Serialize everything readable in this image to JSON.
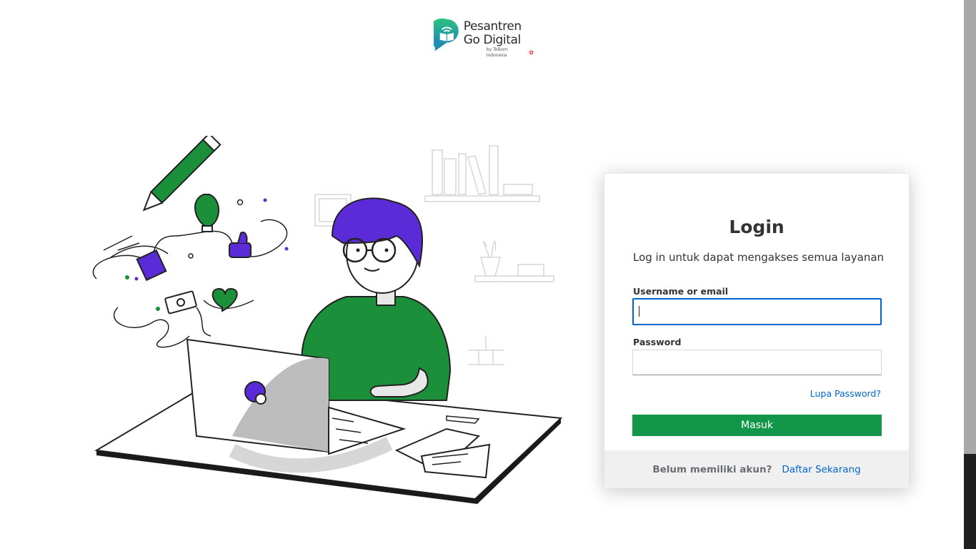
{
  "logo": {
    "line1": "Pesantren",
    "line2": "Go Digital",
    "sub": "by Telkom Indonesia"
  },
  "login": {
    "title": "Login",
    "subtitle": "Log in untuk dapat mengakses semua layanan",
    "username_label": "Username or email",
    "username_value": "",
    "password_label": "Password",
    "password_value": "",
    "forgot_link": "Lupa Password?",
    "submit_label": "Masuk"
  },
  "footer": {
    "question": "Belum memiliki akun?",
    "register_link": "Daftar Sekarang"
  },
  "colors": {
    "accent_green": "#12964a",
    "link_blue": "#0066cc",
    "illustration_purple": "#5b2bd8",
    "illustration_green": "#1b8f3a"
  },
  "icons": {
    "logo": "book-wifi-icon"
  }
}
